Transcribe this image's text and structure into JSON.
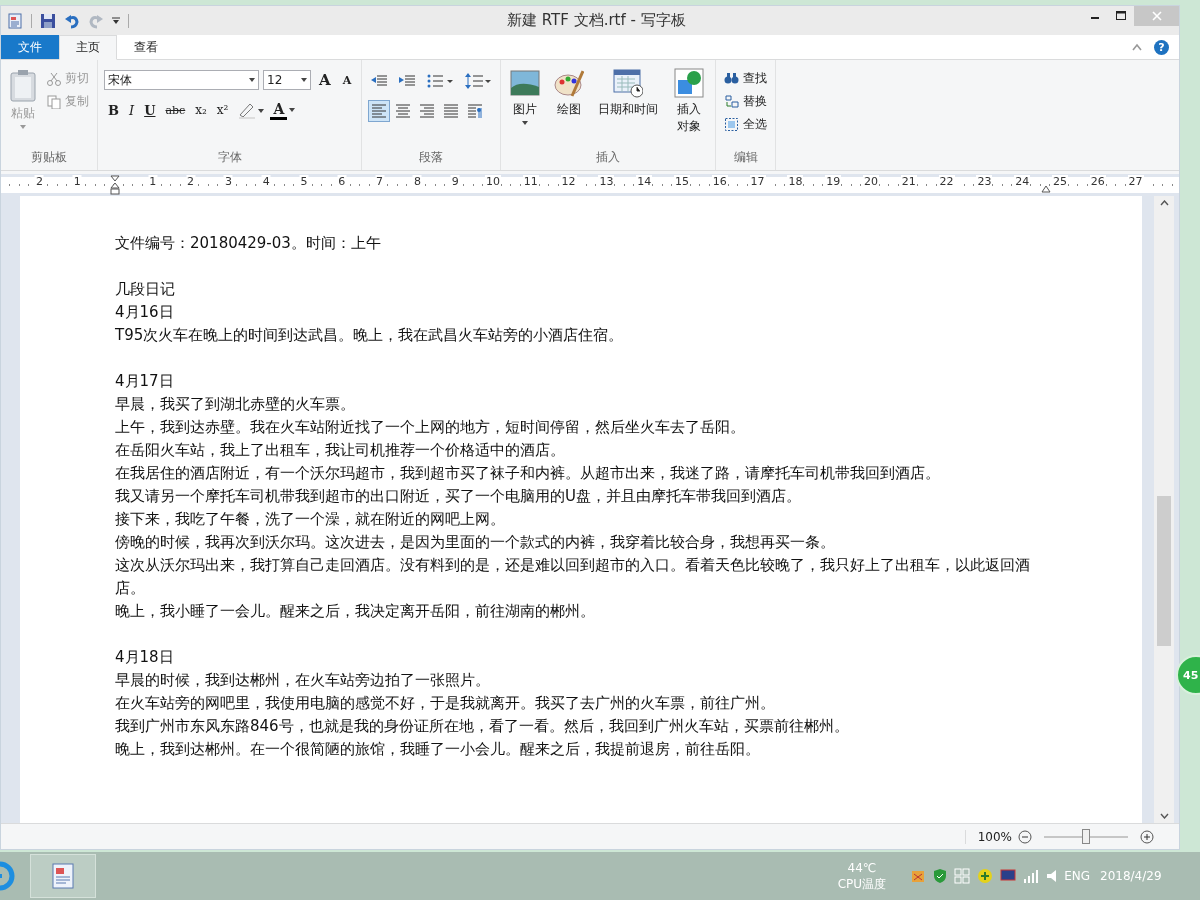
{
  "window": {
    "title": "新建 RTF 文档.rtf - 写字板"
  },
  "ribbon_tabs": [
    {
      "label": "文件",
      "kind": "file",
      "selected": false
    },
    {
      "label": "主页",
      "kind": "tab",
      "selected": true
    },
    {
      "label": "查看",
      "kind": "tab",
      "selected": false
    }
  ],
  "help": {
    "label": "?"
  },
  "clipboard": {
    "title": "剪贴板",
    "paste": {
      "label": "粘贴",
      "disabled": true
    },
    "cut": {
      "label": "剪切",
      "disabled": true
    },
    "copy": {
      "label": "复制",
      "disabled": true
    }
  },
  "font": {
    "title": "字体",
    "family": "宋体",
    "size": "12",
    "size_buttons": [
      {
        "label": "A",
        "kind": "grow"
      },
      {
        "label": "A",
        "kind": "shrink"
      }
    ],
    "format_buttons": [
      {
        "label": "B",
        "kind": "bold"
      },
      {
        "label": "I",
        "kind": "italic"
      },
      {
        "label": "U",
        "kind": "underline"
      },
      {
        "label": "abc",
        "kind": "strike"
      },
      {
        "label": "x₂",
        "kind": "sub"
      },
      {
        "label": "x²",
        "kind": "sup"
      }
    ],
    "color_button": {
      "label": "A"
    }
  },
  "paragraph": {
    "title": "段落",
    "align": [
      {
        "kind": "left",
        "selected": true
      },
      {
        "kind": "center",
        "selected": false
      },
      {
        "kind": "right",
        "selected": false
      },
      {
        "kind": "justify",
        "selected": false
      }
    ]
  },
  "insert": {
    "title": "插入",
    "items": [
      {
        "label": "图片",
        "kind": "picture"
      },
      {
        "label": "绘图",
        "kind": "paint"
      },
      {
        "label": "日期和时间",
        "kind": "datetime"
      },
      {
        "label": "插入对象",
        "kind": "object"
      }
    ]
  },
  "editing": {
    "title": "编辑",
    "items": [
      {
        "label": "查找",
        "kind": "find"
      },
      {
        "label": "替换",
        "kind": "replace"
      },
      {
        "label": "全选",
        "kind": "selectall"
      }
    ]
  },
  "ruler": {
    "left_labels": [
      "2",
      "1"
    ],
    "right_labels": [
      "1",
      "2",
      "3",
      "4",
      "5",
      "6",
      "7",
      "8",
      "9",
      "10",
      "11",
      "12",
      "13",
      "14",
      "15",
      "16",
      "17",
      "18",
      "19",
      "20",
      "21",
      "22",
      "23",
      "24",
      "25",
      "26",
      "27"
    ]
  },
  "document": {
    "sections": [
      {
        "lines": [
          "文件编号：20180429-03。时间：上午"
        ]
      },
      {
        "lines": [
          "几段日记",
          "4月16日",
          "T95次火车在晚上的时间到达武昌。晚上，我在武昌火车站旁的小酒店住宿。"
        ]
      },
      {
        "lines": [
          "4月17日",
          "早晨，我买了到湖北赤壁的火车票。",
          "上午，我到达赤壁。我在火车站附近找了一个上网的地方，短时间停留，然后坐火车去了岳阳。",
          "在岳阳火车站，我上了出租车，我让司机推荐一个价格适中的酒店。",
          "在我居住的酒店附近，有一个沃尔玛超市，我到超市买了袜子和内裤。从超市出来，我迷了路，请摩托车司机带我回到酒店。",
          "我又请另一个摩托车司机带我到超市的出口附近，买了一个电脑用的U盘，并且由摩托车带我回到酒店。",
          "接下来，我吃了午餐，洗了一个澡，就在附近的网吧上网。",
          "傍晚的时候，我再次到沃尔玛。这次进去，是因为里面的一个款式的内裤，我穿着比较合身，我想再买一条。",
          "这次从沃尔玛出来，我打算自己走回酒店。没有料到的是，还是难以回到超市的入口。看着天色比较晚了，我只好上了出租车，以此返回酒店。",
          "晚上，我小睡了一会儿。醒来之后，我决定离开岳阳，前往湖南的郴州。"
        ]
      },
      {
        "lines": [
          "4月18日",
          "早晨的时候，我到达郴州，在火车站旁边拍了一张照片。",
          "在火车站旁的网吧里，我使用电脑的感觉不好，于是我就离开。我买了去广州的火车票，前往广州。",
          "我到广州市东风东路846号，也就是我的身份证所在地，看了一看。然后，我回到广州火车站，买票前往郴州。",
          "晚上，我到达郴州。在一个很简陋的旅馆，我睡了一小会儿。醒来之后，我提前退房，前往岳阳。"
        ]
      }
    ]
  },
  "status_bar": {
    "zoom": "100%",
    "zoom_slider": {
      "level": 0.5
    }
  },
  "desktop_widget": {
    "text": "45"
  },
  "taskbar": {
    "temperature": "44℃",
    "temperature_label": "CPU温度",
    "language": "ENG",
    "date": "2018/4/29"
  }
}
